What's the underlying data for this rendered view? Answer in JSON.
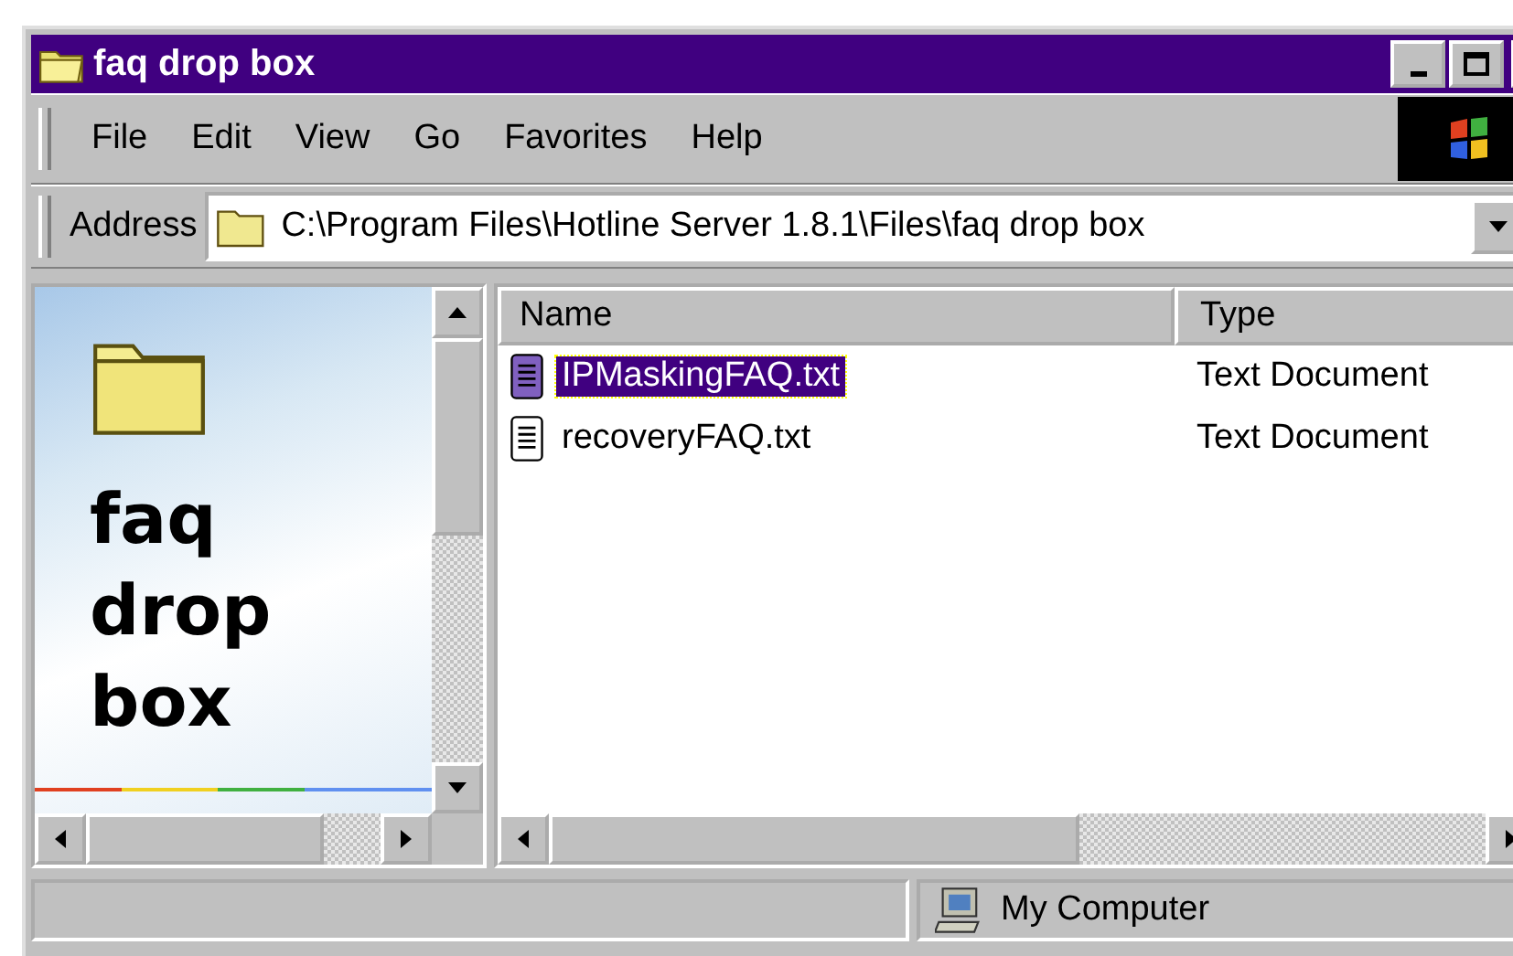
{
  "window": {
    "title": "faq drop box",
    "active": true
  },
  "menu": [
    "File",
    "Edit",
    "View",
    "Go",
    "Favorites",
    "Help"
  ],
  "address": {
    "label": "Address",
    "value": "C:\\Program Files\\Hotline Server 1.8.1\\Files\\faq drop box"
  },
  "side_panel": {
    "title": "faq drop box"
  },
  "table": {
    "columns": [
      "Name",
      "Type"
    ],
    "rows": [
      {
        "name": "IPMaskingFAQ.txt",
        "type": "Text Document",
        "selected": true
      },
      {
        "name": "recoveryFAQ.txt",
        "type": "Text Document",
        "selected": false
      }
    ]
  },
  "status_bar": {
    "zone": "My Computer"
  }
}
